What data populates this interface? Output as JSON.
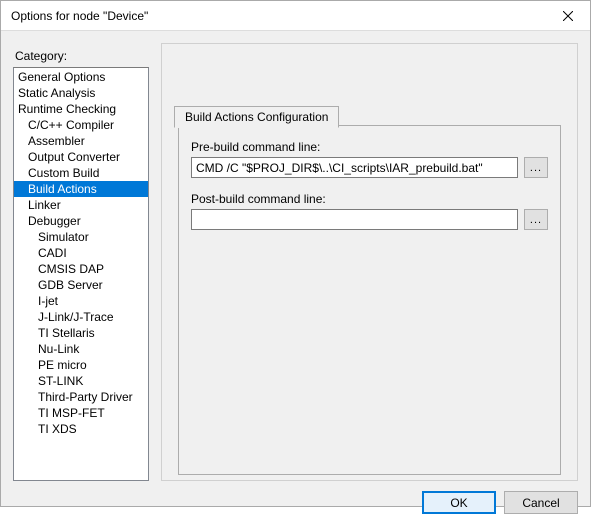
{
  "window": {
    "title": "Options for node \"Device\""
  },
  "category": {
    "label": "Category:",
    "items": [
      {
        "label": "General Options",
        "indent": 0
      },
      {
        "label": "Static Analysis",
        "indent": 0
      },
      {
        "label": "Runtime Checking",
        "indent": 0
      },
      {
        "label": "C/C++ Compiler",
        "indent": 1
      },
      {
        "label": "Assembler",
        "indent": 1
      },
      {
        "label": "Output Converter",
        "indent": 1
      },
      {
        "label": "Custom Build",
        "indent": 1
      },
      {
        "label": "Build Actions",
        "indent": 1,
        "selected": true
      },
      {
        "label": "Linker",
        "indent": 1
      },
      {
        "label": "Debugger",
        "indent": 1
      },
      {
        "label": "Simulator",
        "indent": 2
      },
      {
        "label": "CADI",
        "indent": 2
      },
      {
        "label": "CMSIS DAP",
        "indent": 2
      },
      {
        "label": "GDB Server",
        "indent": 2
      },
      {
        "label": "I-jet",
        "indent": 2
      },
      {
        "label": "J-Link/J-Trace",
        "indent": 2
      },
      {
        "label": "TI Stellaris",
        "indent": 2
      },
      {
        "label": "Nu-Link",
        "indent": 2
      },
      {
        "label": "PE micro",
        "indent": 2
      },
      {
        "label": "ST-LINK",
        "indent": 2
      },
      {
        "label": "Third-Party Driver",
        "indent": 2
      },
      {
        "label": "TI MSP-FET",
        "indent": 2
      },
      {
        "label": "TI XDS",
        "indent": 2
      }
    ]
  },
  "tab": {
    "label": "Build Actions Configuration"
  },
  "fields": {
    "prebuild_label": "Pre-build command line:",
    "prebuild_value": "CMD /C \"$PROJ_DIR$\\..\\CI_scripts\\IAR_prebuild.bat\"",
    "postbuild_label": "Post-build command line:",
    "postbuild_value": "",
    "browse": "..."
  },
  "buttons": {
    "ok": "OK",
    "cancel": "Cancel"
  }
}
